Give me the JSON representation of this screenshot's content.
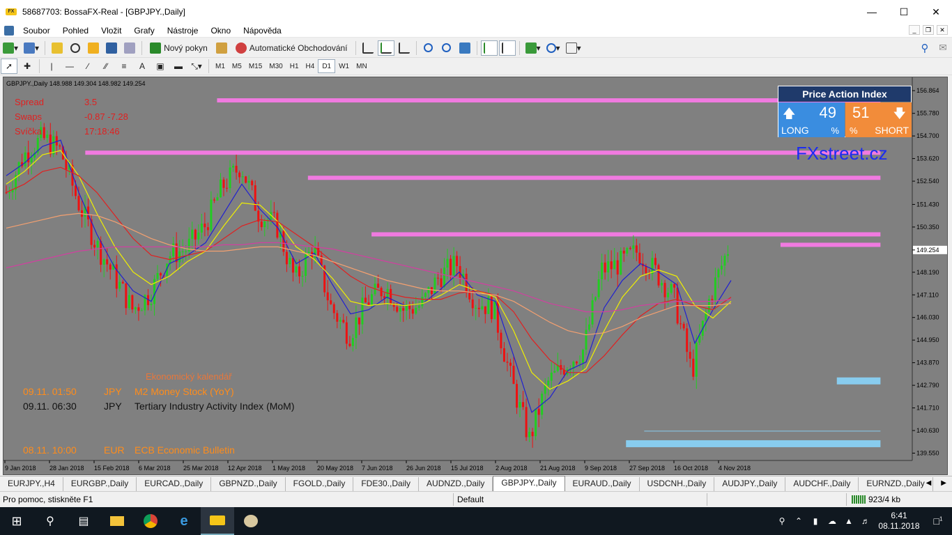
{
  "window": {
    "title": "58687703: BossaFX-Real - [GBPJPY.,Daily]",
    "app_icon_label": "FX"
  },
  "menu": {
    "items": [
      "Soubor",
      "Pohled",
      "Vložit",
      "Grafy",
      "Nástroje",
      "Okno",
      "Nápověda"
    ]
  },
  "toolbar": {
    "new_order": "Nový pokyn",
    "auto_trading": "Automatické Obchodování"
  },
  "timeframes": {
    "items": [
      "M1",
      "M5",
      "M15",
      "M30",
      "H1",
      "H4",
      "D1",
      "W1",
      "MN"
    ],
    "selected": "D1"
  },
  "chart": {
    "symbol_line": "GBPJPY.,Daily  148.988 149.304 148.982 149.254",
    "info": [
      {
        "label": "Spread",
        "value": "3.5"
      },
      {
        "label": "Swaps",
        "value": "-0.87 -7.28"
      },
      {
        "label": "Svíčka",
        "value": "17:18:46"
      }
    ],
    "calendar": {
      "title": "Ekonomický kalendář",
      "events": [
        {
          "date": "09.11. 01:50",
          "currency": "JPY",
          "event": "M2 Money Stock (YoY)"
        },
        {
          "date": "09.11. 06:30",
          "currency": "JPY",
          "event": "Tertiary Industry Activity Index (MoM)"
        },
        {
          "date": "08.11. 10:00",
          "currency": "EUR",
          "event": "ECB Economic Bulletin"
        }
      ]
    },
    "price_action": {
      "title": "Price Action Index",
      "long_value": "49",
      "long_label": "LONG",
      "short_value": "51",
      "short_label": "SHORT",
      "pct": "%"
    },
    "watermark": "FXstreet.cz"
  },
  "chart_data": {
    "type": "candlestick",
    "symbol": "GBPJPY.",
    "timeframe": "Daily",
    "current_price": "149.254",
    "y_ticks": [
      "156.864",
      "155.780",
      "154.700",
      "153.620",
      "152.540",
      "151.430",
      "150.350",
      "149.254",
      "148.190",
      "147.110",
      "146.030",
      "144.950",
      "143.870",
      "142.790",
      "141.710",
      "140.630",
      "139.550"
    ],
    "y_tick_values": [
      156.864,
      155.78,
      154.7,
      153.62,
      152.54,
      151.43,
      150.35,
      149.254,
      148.19,
      147.11,
      146.03,
      144.95,
      143.87,
      142.79,
      141.71,
      140.63,
      139.55
    ],
    "x_ticks": [
      "9 Jan 2018",
      "28 Jan 2018",
      "15 Feb 2018",
      "6 Mar 2018",
      "25 Mar 2018",
      "12 Apr 2018",
      "1 May 2018",
      "20 May 2018",
      "7 Jun 2018",
      "26 Jun 2018",
      "15 Jul 2018",
      "2 Aug 2018",
      "21 Aug 2018",
      "9 Sep 2018",
      "27 Sep 2018",
      "16 Oct 2018",
      "4 Nov 2018"
    ],
    "ylim": [
      139.2,
      157.5
    ],
    "resistance_levels": [
      {
        "price": 156.4,
        "from": 0.235,
        "to": 0.965
      },
      {
        "price": 153.9,
        "from": 0.09,
        "to": 0.965
      },
      {
        "price": 152.7,
        "from": 0.335,
        "to": 0.965
      },
      {
        "price": 150.0,
        "from": 0.405,
        "to": 0.965
      },
      {
        "price": 149.5,
        "from": 0.855,
        "to": 0.965
      }
    ],
    "support_levels": [
      {
        "price": 143.0,
        "from": 0.917,
        "to": 0.965
      },
      {
        "price": 140.0,
        "from": 0.685,
        "to": 0.965
      }
    ],
    "support_line": {
      "price": 140.6,
      "from": 0.705,
      "to": 0.965
    },
    "ma_series": [
      {
        "color": "#2020d0",
        "values": [
          152.8,
          153.4,
          154.2,
          154.5,
          152.0,
          150.0,
          148.4,
          147.3,
          146.8,
          148.6,
          149.0,
          149.6,
          151.0,
          152.4,
          151.2,
          150.3,
          148.6,
          149.1,
          147.6,
          146.2,
          146.4,
          147.0,
          146.6,
          146.7,
          147.4,
          148.2,
          147.1,
          146.8,
          144.2,
          141.5,
          142.2,
          143.5,
          143.9,
          146.5,
          147.8,
          148.6,
          148.2,
          147.6,
          144.8,
          146.4,
          147.8
        ]
      },
      {
        "color": "#f0f000",
        "values": [
          152.4,
          153.0,
          153.8,
          154.0,
          152.8,
          151.0,
          149.4,
          148.2,
          147.6,
          148.0,
          148.7,
          149.2,
          150.4,
          151.5,
          151.4,
          150.6,
          149.4,
          148.8,
          147.9,
          146.8,
          146.6,
          146.7,
          146.6,
          146.7,
          147.1,
          147.6,
          147.3,
          147.0,
          145.4,
          143.4,
          142.6,
          143.0,
          143.6,
          145.4,
          147.0,
          148.0,
          148.3,
          148.0,
          146.6,
          146.0,
          146.8
        ]
      },
      {
        "color": "#e02020",
        "values": [
          152.0,
          152.4,
          153.0,
          153.2,
          152.8,
          152.0,
          150.9,
          149.8,
          149.0,
          148.8,
          149.0,
          149.2,
          149.8,
          150.4,
          150.7,
          150.6,
          150.0,
          149.4,
          148.7,
          148.0,
          147.5,
          147.2,
          147.0,
          146.9,
          146.9,
          147.2,
          147.3,
          147.1,
          146.3,
          145.0,
          144.0,
          143.4,
          143.4,
          144.2,
          145.2,
          146.1,
          146.7,
          146.9,
          146.6,
          146.4,
          147.0
        ]
      },
      {
        "color": "#f4a070",
        "values": [
          150.3,
          150.5,
          150.7,
          150.9,
          151.0,
          150.9,
          150.6,
          150.2,
          149.8,
          149.5,
          149.3,
          149.2,
          149.2,
          149.3,
          149.4,
          149.4,
          149.2,
          149.0,
          148.7,
          148.4,
          148.1,
          147.8,
          147.6,
          147.4,
          147.3,
          147.3,
          147.2,
          147.1,
          146.8,
          146.3,
          145.8,
          145.4,
          145.2,
          145.3,
          145.6,
          146.0,
          146.3,
          146.6,
          146.6,
          146.6,
          146.7
        ]
      },
      {
        "color": "#d040a0",
        "values": [
          148.4,
          148.6,
          148.8,
          149.0,
          149.2,
          149.3,
          149.4,
          149.4,
          149.4,
          149.4,
          149.4,
          149.4,
          149.5,
          149.5,
          149.6,
          149.6,
          149.5,
          149.4,
          149.3,
          149.1,
          148.9,
          148.7,
          148.5,
          148.3,
          148.1,
          147.9,
          147.7,
          147.5,
          147.3,
          147.0,
          146.7,
          146.5,
          146.3,
          146.3,
          146.4,
          146.6,
          146.7,
          146.8,
          146.8,
          146.8,
          146.9
        ]
      }
    ],
    "price_path": [
      152.0,
      153.8,
      154.6,
      154.0,
      151.5,
      149.5,
      148.0,
      146.4,
      147.2,
      149.0,
      149.3,
      150.4,
      152.3,
      153.3,
      151.0,
      150.4,
      147.8,
      149.4,
      146.5,
      145.2,
      146.8,
      147.5,
      146.4,
      146.6,
      148.0,
      148.6,
      146.8,
      146.5,
      143.0,
      140.2,
      142.9,
      143.8,
      144.5,
      148.3,
      148.6,
      149.2,
      148.2,
      147.0,
      143.4,
      147.0,
      149.3
    ]
  },
  "tabs": {
    "items": [
      "EURJPY.,H4",
      "EURGBP.,Daily",
      "EURCAD.,Daily",
      "GBPNZD.,Daily",
      "FGOLD.,Daily",
      "FDE30.,Daily",
      "AUDNZD.,Daily",
      "GBPJPY.,Daily",
      "EURAUD.,Daily",
      "USDCNH.,Daily",
      "AUDJPY.,Daily",
      "AUDCHF.,Daily",
      "EURNZD.,Daily"
    ],
    "active": "GBPJPY.,Daily"
  },
  "status": {
    "help": "Pro pomoc, stiskněte F1",
    "profile": "Default",
    "traffic": "923/4 kb"
  },
  "taskbar": {
    "time": "6:41",
    "date": "08.11.2018",
    "notif_count": "1"
  }
}
